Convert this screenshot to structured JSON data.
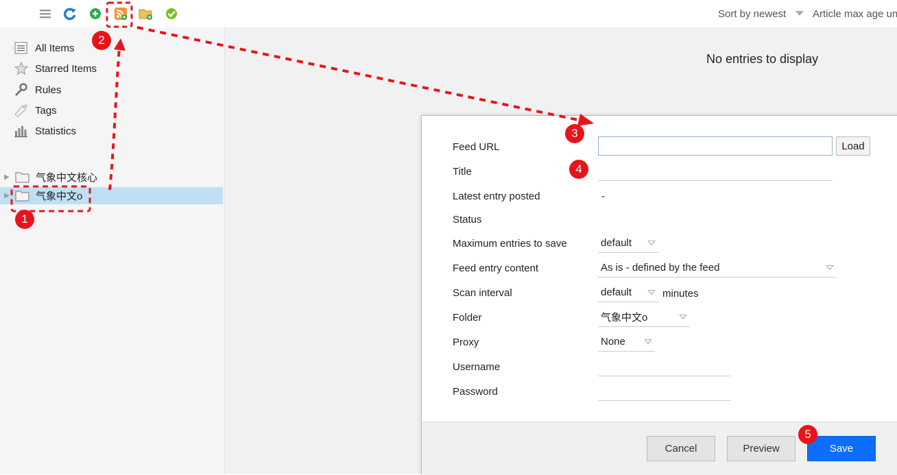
{
  "toolbar": {
    "icons": [
      "menu-icon",
      "refresh-icon",
      "add-icon",
      "rss-feed-icon",
      "add-folder-icon",
      "mark-read-icon"
    ],
    "sort_label": "Sort by newest",
    "age_label": "Article max age un"
  },
  "sidebar": {
    "items": [
      {
        "label": "All Items",
        "icon": "list-icon"
      },
      {
        "label": "Starred Items",
        "icon": "star-icon"
      },
      {
        "label": "Rules",
        "icon": "wrench-icon"
      },
      {
        "label": "Tags",
        "icon": "tag-icon"
      },
      {
        "label": "Statistics",
        "icon": "bar-chart-icon"
      }
    ],
    "folders": [
      {
        "label": "气象中文核心",
        "selected": false
      },
      {
        "label": "气象中文o",
        "selected": true
      }
    ]
  },
  "main": {
    "empty_message": "No entries to display"
  },
  "dialog": {
    "feed_url_label": "Feed URL",
    "feed_url_value": "",
    "load_button": "Load",
    "title_label": "Title",
    "latest_entry_label": "Latest entry posted",
    "latest_entry_value": "-",
    "status_label": "Status",
    "max_entries_label": "Maximum entries to save",
    "max_entries_value": "default",
    "entry_content_label": "Feed entry content",
    "entry_content_value": "As is - defined by the feed",
    "scan_interval_label": "Scan interval",
    "scan_interval_value": "default",
    "scan_interval_unit": "minutes",
    "folder_label": "Folder",
    "folder_value": "气象中文o",
    "proxy_label": "Proxy",
    "proxy_value": "None",
    "username_label": "Username",
    "password_label": "Password",
    "cancel_button": "Cancel",
    "preview_button": "Preview",
    "save_button": "Save"
  },
  "annotations": {
    "badges": [
      "1",
      "2",
      "3",
      "4",
      "5"
    ],
    "color": "#e8141b"
  },
  "colors": {
    "selected_folder_bg": "#bfe0f3",
    "primary_button": "#0d6efd"
  }
}
